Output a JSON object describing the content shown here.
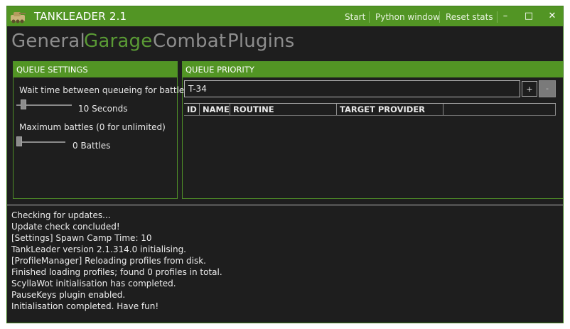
{
  "window": {
    "title": "TANKLEADER 2.1",
    "menu": [
      "Start",
      "Python window",
      "Reset stats"
    ],
    "controls": {
      "minimize": "–",
      "maximize": "□",
      "close": "✕"
    }
  },
  "tabs": [
    {
      "label": "General",
      "active": false
    },
    {
      "label": "Garage",
      "active": true
    },
    {
      "label": "Combat",
      "active": false
    },
    {
      "label": "Plugins",
      "active": false
    }
  ],
  "queue_settings": {
    "header": "QUEUE SETTINGS",
    "wait_label": "Wait time between queueing for battles:",
    "wait_value": "10 Seconds",
    "max_label": "Maximum battles (0 for unlimited)",
    "max_value": "0 Battles"
  },
  "queue_priority": {
    "header": "QUEUE PRIORITY",
    "input_value": "T-34",
    "add_label": "+",
    "remove_label": "-",
    "columns": [
      "ID",
      "NAME",
      "ROUTINE",
      "TARGET PROVIDER"
    ]
  },
  "log": [
    "Checking for updates...",
    "Update check concluded!",
    "[Settings] Spawn Camp Time: 10",
    "TankLeader version 2.1.314.0 initialising.",
    "[ProfileManager] Reloading profiles from disk.",
    "Finished loading profiles; found 0 profiles in total.",
    "ScyllaWot initialisation has completed.",
    "PauseKeys plugin enabled.",
    "Initialisation completed. Have fun!"
  ],
  "colors": {
    "accent": "#529524",
    "active_tab": "#5a9a35",
    "background": "#1e1e1e"
  }
}
